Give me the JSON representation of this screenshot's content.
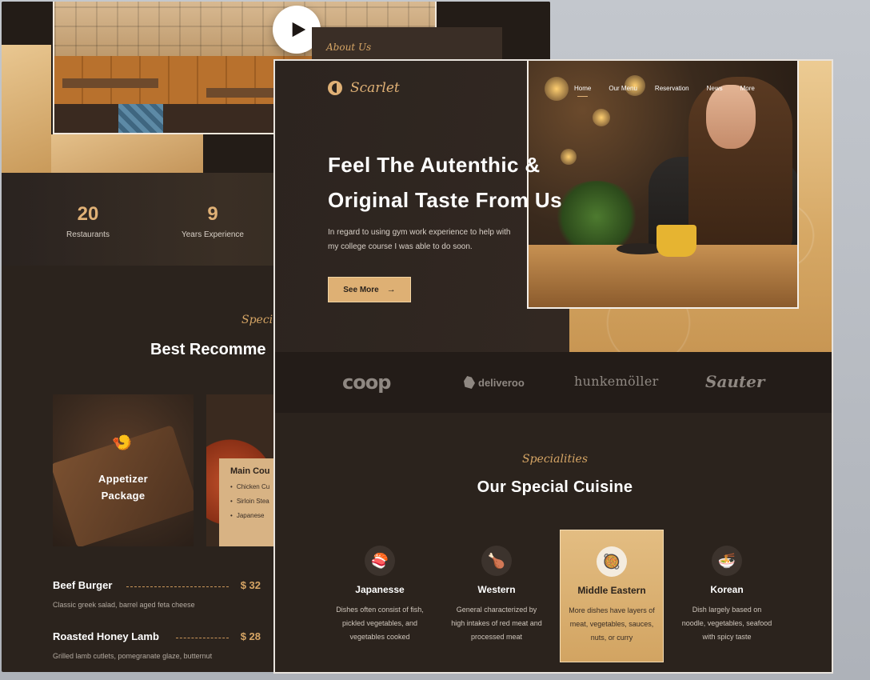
{
  "back": {
    "about_label": "About Us",
    "stats": [
      {
        "value": "20",
        "label": "Restaurants"
      },
      {
        "value": "9",
        "label": "Years Experience"
      }
    ],
    "special_label": "Speci",
    "best_title": "Best Recomme",
    "package": {
      "title_line1": "Appetizer",
      "title_line2": "Package",
      "icon": "shrimp-icon"
    },
    "main_course": {
      "title": "Main Cou",
      "items": [
        "Chicken Cu",
        "Sirloin Stea",
        "Japanese"
      ]
    },
    "menu": [
      {
        "name": "Beef Burger",
        "price": "$ 32",
        "desc": "Classic greek salad, barrel aged feta cheese"
      },
      {
        "name": "Roasted Honey Lamb",
        "price": "$ 28",
        "desc": "Grilled lamb cutlets, pomegranate glaze, butternut"
      }
    ]
  },
  "front": {
    "brand": "Scarlet",
    "nav": [
      "Home",
      "Our Menu",
      "Reservation",
      "News",
      "More"
    ],
    "nav_active": "Home",
    "hero_title_line1": "Feel The Autenthic &",
    "hero_title_line2": "Original Taste From Us",
    "hero_sub": "In regard to using gym work experience to help with my college course I was able to do soon.",
    "cta_label": "See More",
    "partners": [
      "coop",
      "deliveroo",
      "hunkemöller",
      "Sauter"
    ],
    "spec_label": "Specialities",
    "spec_title": "Our Special Cuisine",
    "cuisines": [
      {
        "name": "Japanesse",
        "icon": "sushi-icon",
        "desc": "Dishes often consist of fish, pickled vegetables, and vegetables cooked"
      },
      {
        "name": "Western",
        "icon": "drumstick-icon",
        "desc": "General characterized by high intakes of red meat and processed meat"
      },
      {
        "name": "Middle Eastern",
        "icon": "pan-icon",
        "desc": "More dishes have layers of meat, vegetables, sauces, nuts, or curry",
        "selected": true
      },
      {
        "name": "Korean",
        "icon": "bowl-icon",
        "desc": "Dish largely based on noodle, vegetables, seafood with spicy taste"
      }
    ]
  },
  "colors": {
    "accent": "#deb074",
    "dark": "#2b231d",
    "background": "#b9bdc3"
  }
}
